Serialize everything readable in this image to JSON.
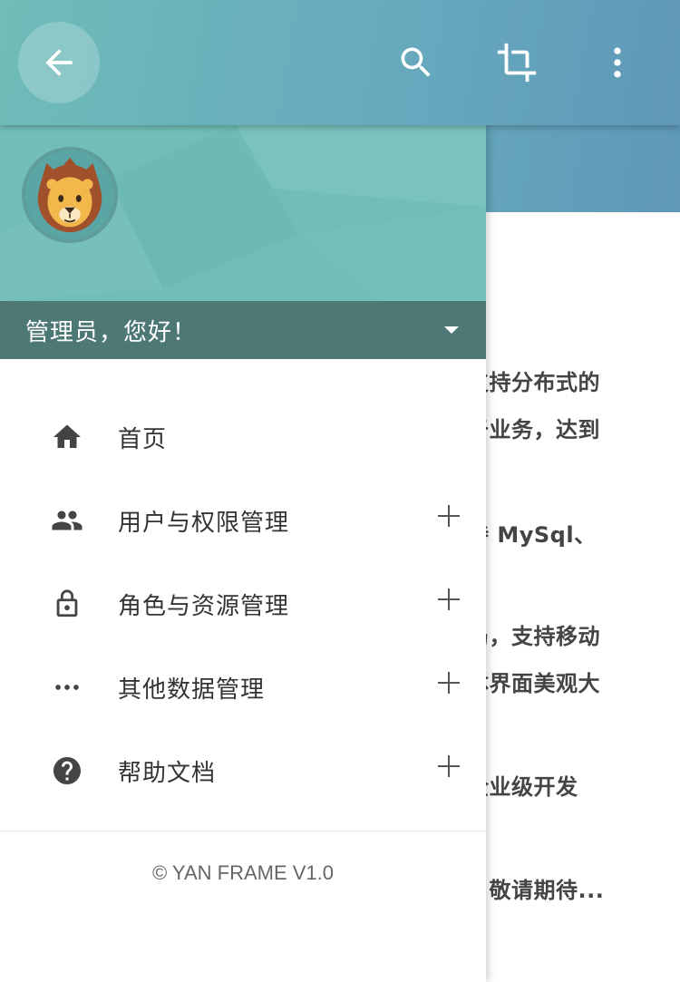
{
  "background_page": {
    "lines": [
      "支持分布式的",
      "于业务，达到",
      "持 MySql、",
      "局，支持移动",
      "体界面美观大",
      "企业级开发",
      "，敬请期待..."
    ]
  },
  "appbar": {
    "icons": [
      "arrow-back-icon",
      "search-icon",
      "crop-icon",
      "more-vert-icon"
    ]
  },
  "drawer": {
    "greeting": "管理员，您好！",
    "menu": [
      {
        "label": "首页",
        "icon": "home-icon",
        "expandable": false
      },
      {
        "label": "用户与权限管理",
        "icon": "people-icon",
        "expandable": true
      },
      {
        "label": "角色与资源管理",
        "icon": "lock-icon",
        "expandable": true
      },
      {
        "label": "其他数据管理",
        "icon": "more-horiz-icon",
        "expandable": true
      },
      {
        "label": "帮助文档",
        "icon": "help-icon",
        "expandable": true
      }
    ],
    "footer": "© YAN FRAME V1.0"
  },
  "colors": {
    "header_teal": "#72bdb8",
    "greeting_bar": "#4d7876",
    "text_dark": "#333333"
  }
}
